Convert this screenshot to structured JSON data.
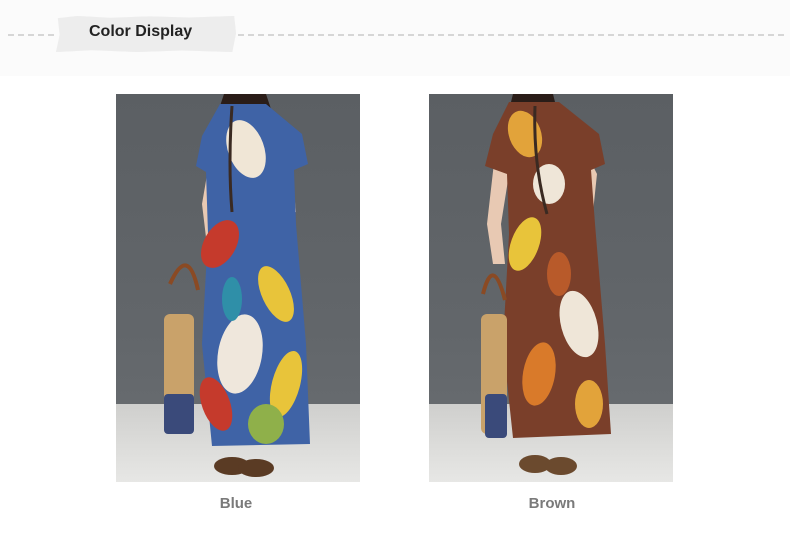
{
  "section": {
    "title": "Color Display"
  },
  "variants": [
    {
      "label": "Blue",
      "swatch": "#3f63a6",
      "accent": "#e8c43a"
    },
    {
      "label": "Brown",
      "swatch": "#7a3f2a",
      "accent": "#e2a33a"
    }
  ]
}
